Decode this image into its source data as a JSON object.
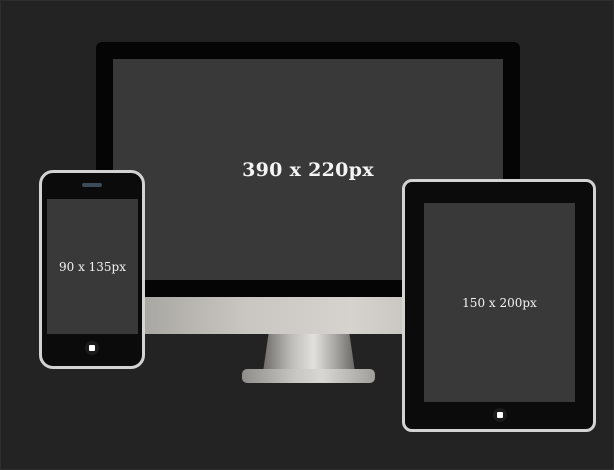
{
  "devices": {
    "desktop": {
      "icon": "desktop-monitor-icon",
      "screen_label": "390 x 220px"
    },
    "phone": {
      "icon": "smartphone-icon",
      "screen_label": "90 x 135px"
    },
    "tablet": {
      "icon": "tablet-icon",
      "screen_label": "150 x 200px"
    }
  },
  "colors": {
    "background": "#232323",
    "screen": "#393939",
    "bezel": "#050505",
    "device_frame": "#d3d3d3",
    "label_text": "#f4f4f4"
  }
}
